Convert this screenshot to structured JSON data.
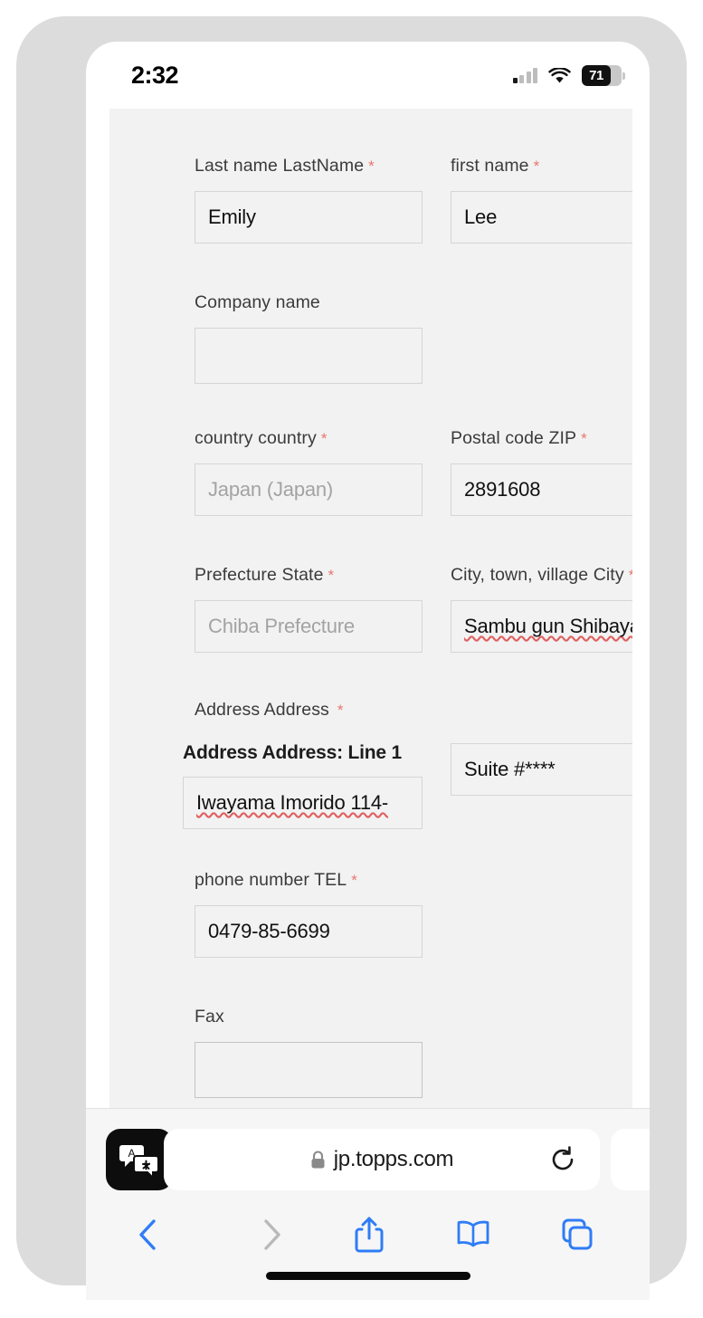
{
  "status_bar": {
    "time": "2:32",
    "signal_icon": "cellular-signal-icon",
    "wifi_icon": "wifi-icon",
    "battery_icon": "battery-icon",
    "battery_percent": "71",
    "battery_level": 71
  },
  "form": {
    "fields": [
      {
        "id": "last-name",
        "label": "Last name LastName",
        "required": true,
        "value": "Emily",
        "placeholder": "",
        "is_placeholder": false,
        "misspelled": false
      },
      {
        "id": "first-name",
        "label": "first name",
        "required": true,
        "value": "Lee",
        "placeholder": "",
        "is_placeholder": false,
        "misspelled": false
      },
      {
        "id": "company-name",
        "label": "Company name",
        "required": false,
        "value": "",
        "placeholder": "",
        "is_placeholder": false,
        "misspelled": false
      },
      {
        "id": "country",
        "label": "country country",
        "required": true,
        "value": "Japan (Japan)",
        "placeholder": "Japan (Japan)",
        "is_placeholder": true,
        "misspelled": false
      },
      {
        "id": "postal-code",
        "label": "Postal code ZIP",
        "required": true,
        "value": "2891608",
        "placeholder": "",
        "is_placeholder": false,
        "misspelled": false
      },
      {
        "id": "prefecture",
        "label": "Prefecture State",
        "required": true,
        "value": "Chiba Prefecture",
        "placeholder": "Chiba Prefecture",
        "is_placeholder": true,
        "misspelled": false
      },
      {
        "id": "city",
        "label": "City, town, village City",
        "required": true,
        "value": "Sambu gun Shibayama",
        "placeholder": "",
        "is_placeholder": false,
        "misspelled": true
      },
      {
        "id": "address",
        "label": "Address Address",
        "required": true,
        "sub_label": "Address Address: Line 1",
        "value": "Iwayama Imorido 114-",
        "placeholder": "",
        "is_placeholder": false,
        "misspelled": true
      },
      {
        "id": "address-line-2",
        "label": "",
        "required": false,
        "value": "Suite #****",
        "placeholder": "",
        "is_placeholder": false,
        "misspelled": false
      },
      {
        "id": "phone",
        "label": "phone number TEL",
        "required": true,
        "value": "0479-85-6699",
        "placeholder": "",
        "is_placeholder": false,
        "misspelled": false
      },
      {
        "id": "fax",
        "label": "Fax",
        "required": false,
        "value": "",
        "placeholder": "",
        "is_placeholder": false,
        "misspelled": false
      }
    ],
    "required_marker": "*"
  },
  "browser": {
    "url": "jp.topps.com",
    "lock_icon": "lock-icon",
    "translate_icon": "translate-icon",
    "reload_icon": "reload-icon",
    "toolbar": {
      "back_icon": "chevron-left-icon",
      "back_enabled": true,
      "forward_icon": "chevron-right-icon",
      "forward_enabled": false,
      "share_icon": "share-icon",
      "bookmarks_icon": "book-icon",
      "tabs_icon": "tabs-icon"
    }
  },
  "colors": {
    "accent_blue": "#2f7cf6",
    "disabled_grey": "#b9b9b9",
    "required_red": "#e8766f",
    "page_bg": "#f2f2f2",
    "frame_grey": "#dcdcdc"
  }
}
